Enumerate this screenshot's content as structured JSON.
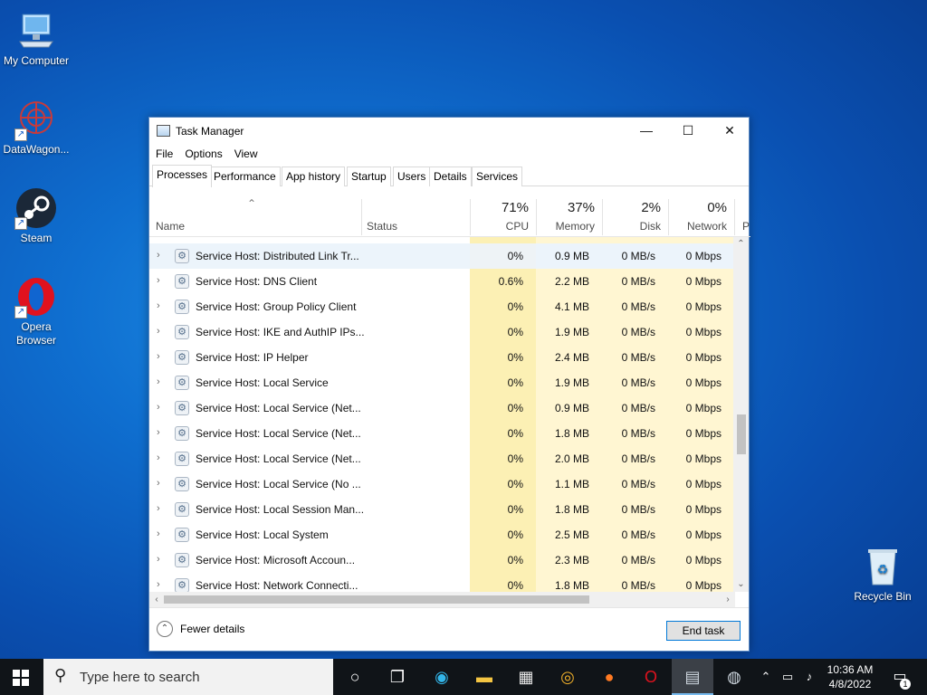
{
  "desktop": {
    "icons": [
      {
        "label": "My Computer"
      },
      {
        "label": "DataWagon..."
      },
      {
        "label": "Steam"
      },
      {
        "label": "Opera\nBrowser"
      },
      {
        "label": "Recycle Bin"
      }
    ]
  },
  "window": {
    "title": "Task Manager",
    "controls": {
      "minimize": "—",
      "maximize": "☐",
      "close": "✕"
    },
    "menu": [
      "File",
      "Options",
      "View"
    ],
    "tabs": [
      "Processes",
      "Performance",
      "App history",
      "Startup",
      "Users",
      "Details",
      "Services"
    ],
    "active_tab": "Processes",
    "columns": {
      "name": "Name",
      "status": "Status",
      "cpu": {
        "pct": "71%",
        "label": "CPU"
      },
      "memory": {
        "pct": "37%",
        "label": "Memory"
      },
      "disk": {
        "pct": "2%",
        "label": "Disk"
      },
      "network": {
        "pct": "0%",
        "label": "Network"
      },
      "more": "P"
    },
    "sort_indicator": "⌃",
    "rows": [
      {
        "name": "Service Host: Distributed Link Tr...",
        "cpu": "0%",
        "memory": "0.9 MB",
        "disk": "0 MB/s",
        "network": "0 Mbps"
      },
      {
        "name": "Service Host: DNS Client",
        "cpu": "0.6%",
        "memory": "2.2 MB",
        "disk": "0 MB/s",
        "network": "0 Mbps"
      },
      {
        "name": "Service Host: Group Policy Client",
        "cpu": "0%",
        "memory": "4.1 MB",
        "disk": "0 MB/s",
        "network": "0 Mbps"
      },
      {
        "name": "Service Host: IKE and AuthIP IPs...",
        "cpu": "0%",
        "memory": "1.9 MB",
        "disk": "0 MB/s",
        "network": "0 Mbps"
      },
      {
        "name": "Service Host: IP Helper",
        "cpu": "0%",
        "memory": "2.4 MB",
        "disk": "0 MB/s",
        "network": "0 Mbps"
      },
      {
        "name": "Service Host: Local Service",
        "cpu": "0%",
        "memory": "1.9 MB",
        "disk": "0 MB/s",
        "network": "0 Mbps"
      },
      {
        "name": "Service Host: Local Service (Net...",
        "cpu": "0%",
        "memory": "0.9 MB",
        "disk": "0 MB/s",
        "network": "0 Mbps"
      },
      {
        "name": "Service Host: Local Service (Net...",
        "cpu": "0%",
        "memory": "1.8 MB",
        "disk": "0 MB/s",
        "network": "0 Mbps"
      },
      {
        "name": "Service Host: Local Service (Net...",
        "cpu": "0%",
        "memory": "2.0 MB",
        "disk": "0 MB/s",
        "network": "0 Mbps"
      },
      {
        "name": "Service Host: Local Service (No ...",
        "cpu": "0%",
        "memory": "1.1 MB",
        "disk": "0 MB/s",
        "network": "0 Mbps"
      },
      {
        "name": "Service Host: Local Session Man...",
        "cpu": "0%",
        "memory": "1.8 MB",
        "disk": "0 MB/s",
        "network": "0 Mbps"
      },
      {
        "name": "Service Host: Local System",
        "cpu": "0%",
        "memory": "2.5 MB",
        "disk": "0 MB/s",
        "network": "0 Mbps"
      },
      {
        "name": "Service Host: Microsoft Accoun...",
        "cpu": "0%",
        "memory": "2.3 MB",
        "disk": "0 MB/s",
        "network": "0 Mbps"
      },
      {
        "name": "Service Host: Network Connecti...",
        "cpu": "0%",
        "memory": "1.8 MB",
        "disk": "0 MB/s",
        "network": "0 Mbps"
      }
    ],
    "footer": {
      "fewer_details": "Fewer details",
      "end_task": "End task"
    }
  },
  "taskbar": {
    "search_placeholder": "Type here to search",
    "time": "10:36 AM",
    "date": "4/8/2022",
    "notification_count": "1"
  },
  "colors": {
    "cpu_cell": "#fcf0b4",
    "other_cell": "#fff6d2",
    "selected_row": "#ecf4fb",
    "accent": "#0078d7"
  }
}
